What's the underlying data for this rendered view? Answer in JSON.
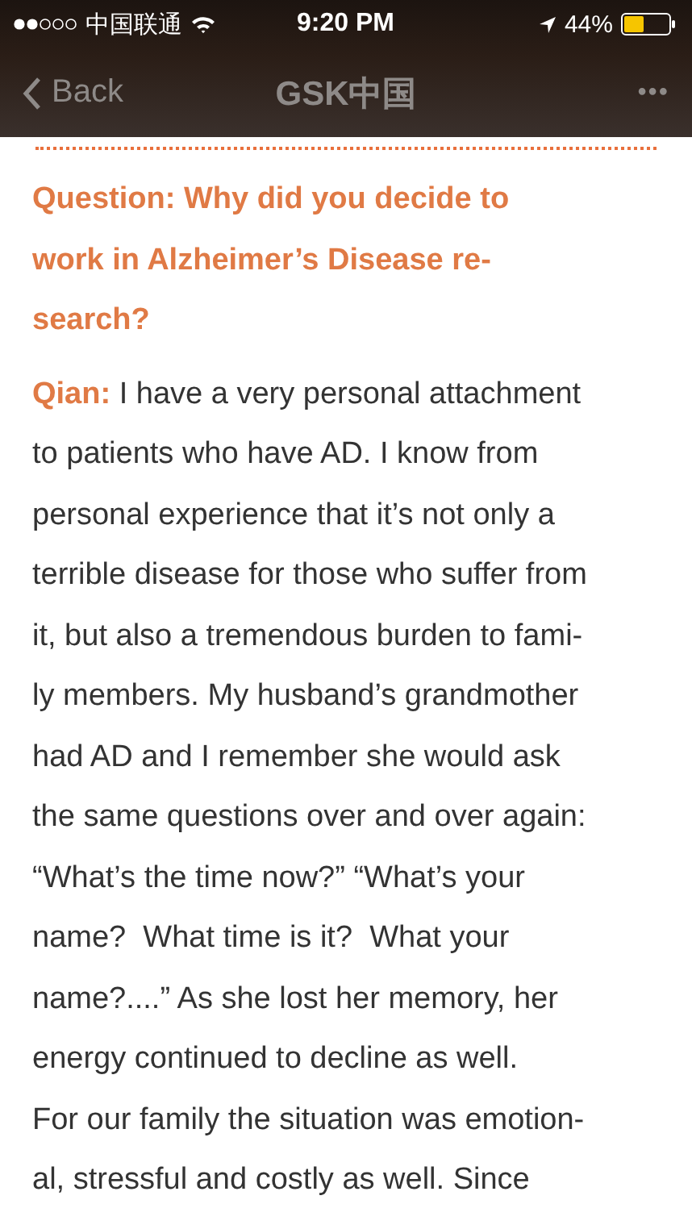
{
  "status_bar": {
    "carrier": "中国联通",
    "time": "9:20 PM",
    "battery": "44%"
  },
  "nav_bar": {
    "back": "Back",
    "title": "GSK中国",
    "more": "•••"
  },
  "article": {
    "question_lines": [
      "Question: Why did you decide to",
      "work in Alzheimer’s Disease re-",
      "search?"
    ],
    "speaker": "Qian:",
    "paragraphs": [
      [
        "I have a very personal attachment",
        "to patients who have AD. I know from",
        "personal experience that it’s not only a",
        "terrible disease for those who suffer from",
        "it, but also a tremendous burden to fami-",
        "ly members. My husband’s grandmother",
        "had AD and I remember she would ask",
        "the same questions over and over again:",
        "“What’s the time now?” “What’s your",
        "name?  What time is it?  What your",
        "name?....” As she lost her memory, her",
        "energy continued to decline as well."
      ],
      [
        "For our family the situation was emotion-",
        "al, stressful and costly as well. Since"
      ]
    ]
  }
}
